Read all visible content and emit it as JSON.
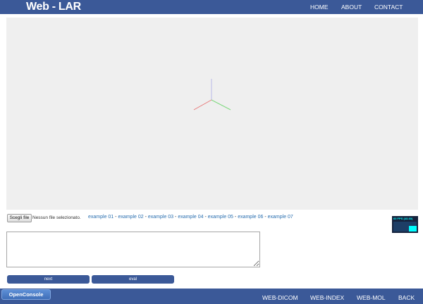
{
  "header": {
    "brand": "Web - LAR",
    "nav": [
      "HOME",
      "ABOUT",
      "CONTACT"
    ]
  },
  "file_input": {
    "button_label": "Scegli file",
    "status": "Nessun file selezionato."
  },
  "examples": [
    "example 01",
    "example 02",
    "example 03",
    "example 04",
    "example 05",
    "example 06",
    "example 07"
  ],
  "examples_separator": " - ",
  "fps_meter": {
    "label": "60 FPS (43-60)"
  },
  "console": {
    "value": ""
  },
  "buttons": {
    "next": "next",
    "eval": "eval"
  },
  "footer": {
    "open_console": "OpenConsole",
    "nav": [
      "WEB-DICOM",
      "WEB-INDEX",
      "WEB-MOL",
      "BACK"
    ]
  },
  "colors": {
    "bar": "#3b5998",
    "viewport": "#efefef",
    "axis_x": "#e87878",
    "axis_y": "#b9b9ea",
    "axis_z": "#7fd97f"
  }
}
